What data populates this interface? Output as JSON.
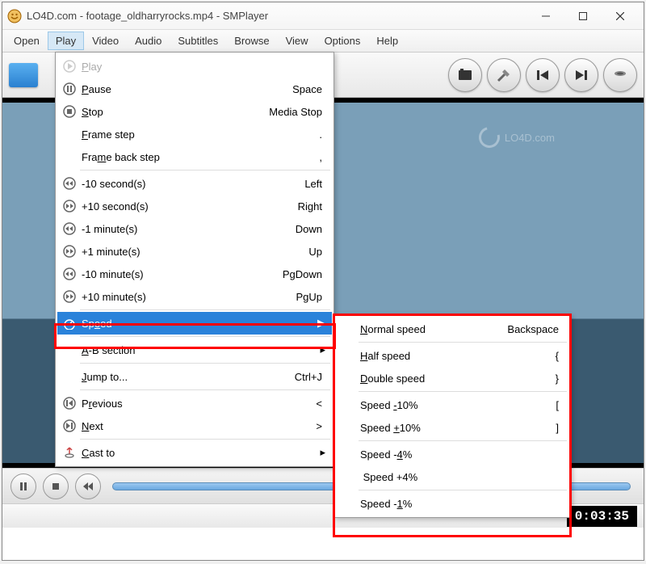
{
  "title": "LO4D.com - footage_oldharryrocks.mp4 - SMPlayer",
  "watermark": "LO4D.com",
  "timecode": "0:03:35",
  "menubar": [
    "Open",
    "Play",
    "Video",
    "Audio",
    "Subtitles",
    "Browse",
    "View",
    "Options",
    "Help"
  ],
  "play_menu": {
    "play": "Play",
    "pause": "Pause",
    "pause_key": "Space",
    "stop": "Stop",
    "stop_key": "Media Stop",
    "frame_step": "Frame step",
    "frame_step_key": ".",
    "frame_back": "Frame back step",
    "frame_back_key": ",",
    "back10s": "-10 second(s)",
    "back10s_key": "Left",
    "fwd10s": "+10 second(s)",
    "fwd10s_key": "Right",
    "back1m": "-1 minute(s)",
    "back1m_key": "Down",
    "fwd1m": "+1 minute(s)",
    "fwd1m_key": "Up",
    "back10m": "-10 minute(s)",
    "back10m_key": "PgDown",
    "fwd10m": "+10 minute(s)",
    "fwd10m_key": "PgUp",
    "speed": "Speed",
    "ab": "A-B section",
    "jump": "Jump to...",
    "jump_key": "Ctrl+J",
    "prev": "Previous",
    "prev_key": "<",
    "next": "Next",
    "next_key": ">",
    "cast": "Cast to"
  },
  "speed_menu": {
    "normal": "Normal speed",
    "normal_key": "Backspace",
    "half": "Half speed",
    "half_key": "{",
    "double": "Double speed",
    "double_key": "}",
    "m10": "Speed -10%",
    "m10_key": "[",
    "p10": "Speed +10%",
    "p10_key": "]",
    "m4": "Speed -4%",
    "p4": "Speed +4%",
    "m1": "Speed -1%"
  }
}
